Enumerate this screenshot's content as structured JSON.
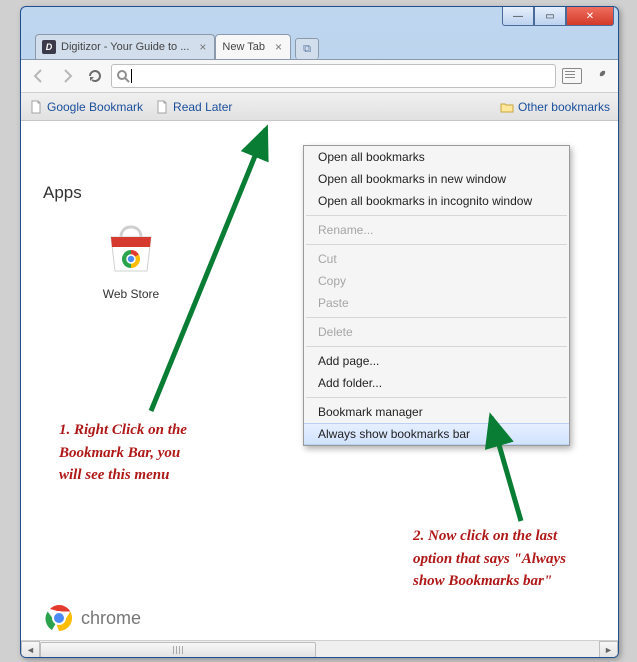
{
  "window": {
    "min_glyph": "—",
    "max_glyph": "▭",
    "close_glyph": "✕"
  },
  "tabs": {
    "bg_title": "Digitizor - Your Guide to ...",
    "fg_title": "New Tab",
    "close_glyph": "×",
    "new_glyph": "+"
  },
  "toolbar": {
    "omnibox_value": ""
  },
  "bookmarks": {
    "items": [
      "Google Bookmark",
      "Read Later"
    ],
    "other": "Other bookmarks"
  },
  "page": {
    "apps_heading": "Apps",
    "webstore_label": "Web Store",
    "chrome_label": "chrome"
  },
  "context_menu": {
    "items": [
      {
        "label": "Open all bookmarks",
        "disabled": false
      },
      {
        "label": "Open all bookmarks in new window",
        "disabled": false
      },
      {
        "label": "Open all bookmarks in incognito window",
        "disabled": false
      }
    ],
    "rename": "Rename...",
    "cut": "Cut",
    "copy": "Copy",
    "paste": "Paste",
    "delete": "Delete",
    "add_page": "Add page...",
    "add_folder": "Add folder...",
    "bm_manager": "Bookmark manager",
    "always_show": "Always show bookmarks bar"
  },
  "annotations": {
    "a1_line1": "1. Right Click on the",
    "a1_line2": "Bookmark Bar, you",
    "a1_line3": "will see this menu",
    "a2_line1": "2. Now click on the last",
    "a2_line2": "option that says \"Always",
    "a2_line3": "show Bookmarks bar\""
  },
  "colors": {
    "arrow": "#0a7d34",
    "annot_text": "#b01818",
    "link": "#1a4f9c"
  }
}
